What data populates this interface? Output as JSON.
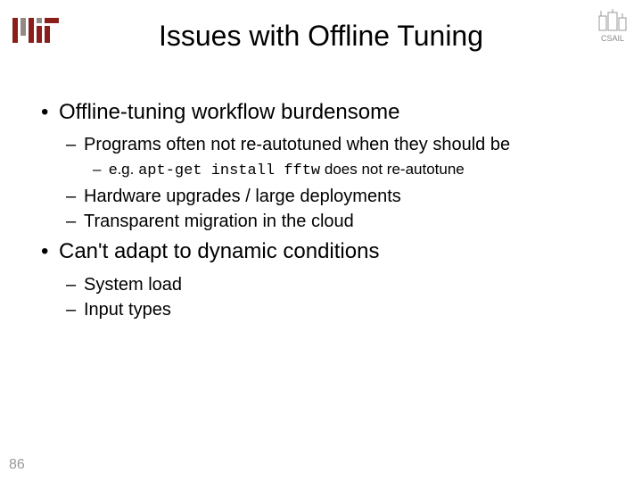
{
  "title": "Issues with Offline Tuning",
  "logo_mit_alt": "MIT",
  "logo_csail_label": "CSAIL",
  "bullets": {
    "b1": {
      "text": "Offline-tuning workflow burdensome",
      "sub": {
        "s1": {
          "text": "Programs often not re-autotuned when they should be",
          "sub": {
            "t1_prefix": "e.g. ",
            "t1_code": "apt-get install fftw",
            "t1_suffix": " does not re-autotune"
          }
        },
        "s2": {
          "text": "Hardware upgrades / large deployments"
        },
        "s3": {
          "text": "Transparent migration in the cloud"
        }
      }
    },
    "b2": {
      "text": "Can't adapt to dynamic conditions",
      "sub": {
        "s1": {
          "text": "System load"
        },
        "s2": {
          "text": "Input types"
        }
      }
    }
  },
  "page_number": "86"
}
